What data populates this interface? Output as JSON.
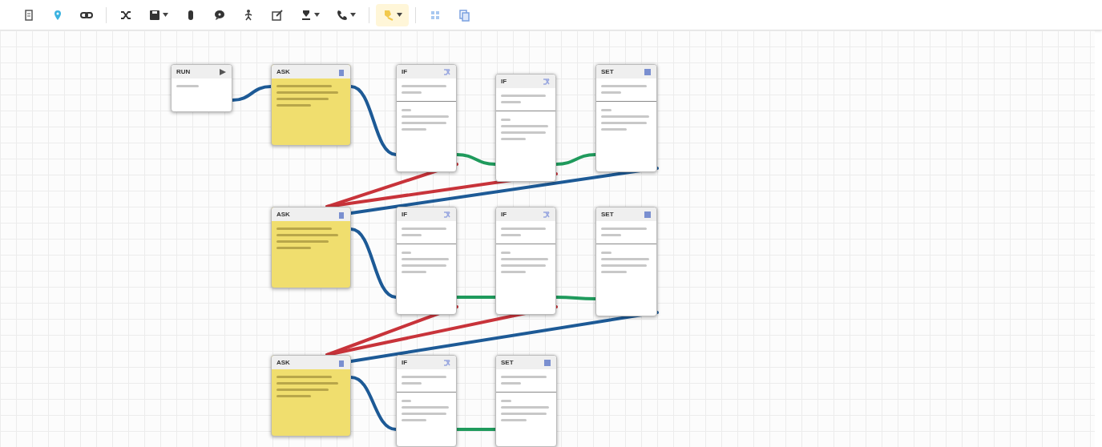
{
  "toolbar_groups": [
    {
      "items": [
        {
          "dropdown": false,
          "active": false
        },
        {
          "dropdown": false,
          "active": false
        },
        {
          "dropdown": false,
          "active": false
        }
      ]
    },
    {
      "items": [
        {
          "dropdown": false,
          "active": false
        },
        {
          "dropdown": true,
          "active": false
        },
        {
          "dropdown": false,
          "active": false
        },
        {
          "dropdown": false,
          "active": false
        },
        {
          "dropdown": false,
          "active": false
        },
        {
          "dropdown": false,
          "active": false
        },
        {
          "dropdown": true,
          "active": false
        },
        {
          "dropdown": true,
          "active": false
        }
      ]
    },
    {
      "items": [
        {
          "dropdown": true,
          "active": true
        }
      ]
    },
    {
      "items": [
        {
          "dropdown": false,
          "active": false
        },
        {
          "dropdown": false,
          "active": false
        }
      ]
    }
  ],
  "nodes": [
    {
      "kind": "run",
      "label": "RUN"
    },
    {
      "kind": "ask",
      "label": "ASK"
    },
    {
      "kind": "if",
      "label": "IF"
    },
    {
      "kind": "if",
      "label": "IF"
    },
    {
      "kind": "set",
      "label": "SET"
    },
    {
      "kind": "ask",
      "label": "ASK"
    },
    {
      "kind": "if",
      "label": "IF"
    },
    {
      "kind": "if",
      "label": "IF"
    },
    {
      "kind": "set",
      "label": "SET"
    },
    {
      "kind": "ask",
      "label": "ASK"
    },
    {
      "kind": "if",
      "label": "IF"
    },
    {
      "kind": "set",
      "label": "SET"
    }
  ],
  "edges": [
    {
      "kind": "next"
    },
    {
      "kind": "next"
    },
    {
      "kind": "yes"
    },
    {
      "kind": "yes"
    },
    {
      "kind": "no"
    },
    {
      "kind": "no"
    },
    {
      "kind": "next"
    },
    {
      "kind": "next"
    },
    {
      "kind": "yes"
    },
    {
      "kind": "yes"
    },
    {
      "kind": "no"
    },
    {
      "kind": "no"
    },
    {
      "kind": "next"
    },
    {
      "kind": "next"
    },
    {
      "kind": "yes"
    }
  ]
}
